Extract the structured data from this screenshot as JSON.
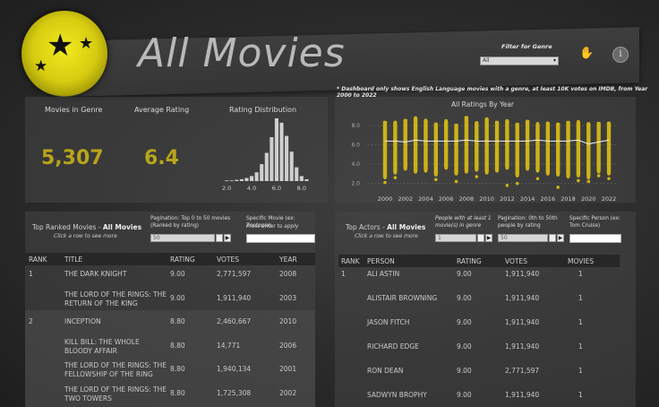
{
  "header": {
    "title": "All Movies",
    "filter_label": "Filter for Genre",
    "genre_selected": "All",
    "note": "* Dashboard only shows English Language movies with a genre, at least 10K votes on IMDB, from Year 2000 to 2022"
  },
  "icons": {
    "logo": "three-stars-logo",
    "hand": "hand-icon",
    "info": "info-icon",
    "info_glyph": "i",
    "hand_glyph": "✋",
    "star_glyph": "★",
    "dropdown_glyph": "▾",
    "next_glyph": "▶"
  },
  "kpis": {
    "movies_label": "Movies in Genre",
    "movies_value": "5,307",
    "rating_label": "Average Rating",
    "rating_value": "6.4",
    "dist_label": "Rating Distribution"
  },
  "distribution": {
    "ticks": [
      "2.0",
      "4.0",
      "6.0",
      "8.0"
    ],
    "tick_values": [
      2,
      4,
      6,
      8
    ],
    "xlim": [
      1.2,
      8.8
    ],
    "bins": [
      {
        "x": 2.0,
        "h": 0.01
      },
      {
        "x": 2.4,
        "h": 0.01
      },
      {
        "x": 2.8,
        "h": 0.02
      },
      {
        "x": 3.2,
        "h": 0.03
      },
      {
        "x": 3.6,
        "h": 0.05
      },
      {
        "x": 4.0,
        "h": 0.08
      },
      {
        "x": 4.4,
        "h": 0.14
      },
      {
        "x": 4.8,
        "h": 0.27
      },
      {
        "x": 5.2,
        "h": 0.45
      },
      {
        "x": 5.6,
        "h": 0.7
      },
      {
        "x": 6.0,
        "h": 1.0
      },
      {
        "x": 6.4,
        "h": 0.93
      },
      {
        "x": 6.8,
        "h": 0.72
      },
      {
        "x": 7.2,
        "h": 0.47
      },
      {
        "x": 7.6,
        "h": 0.22
      },
      {
        "x": 8.0,
        "h": 0.08
      },
      {
        "x": 8.4,
        "h": 0.03
      }
    ],
    "bar_color": "#cfcfcf"
  },
  "chart_data": {
    "type": "scatter",
    "title": "All Ratings By Year",
    "xlabel": "",
    "ylabel": "",
    "ylim": [
      1.5,
      9.5
    ],
    "y_ticks": [
      "8.0",
      "6.0",
      "4.0",
      "2.0"
    ],
    "y_tick_values": [
      8,
      6,
      4,
      2
    ],
    "x_ticks": [
      "2000",
      "2002",
      "2004",
      "2006",
      "2008",
      "2010",
      "2012",
      "2014",
      "2016",
      "2018",
      "2020",
      "2022"
    ],
    "years": [
      2000,
      2001,
      2002,
      2003,
      2004,
      2005,
      2006,
      2007,
      2008,
      2009,
      2010,
      2011,
      2012,
      2013,
      2014,
      2015,
      2016,
      2017,
      2018,
      2019,
      2020,
      2021,
      2022
    ],
    "band_min": [
      2.6,
      3.1,
      3.5,
      3.2,
      3.3,
      2.9,
      3.6,
      3.0,
      3.2,
      3.4,
      3.1,
      3.3,
      3.6,
      2.8,
      3.5,
      3.3,
      3.0,
      2.9,
      2.7,
      2.8,
      2.6,
      3.2,
      3.0
    ],
    "band_max": [
      8.5,
      8.4,
      8.7,
      8.9,
      8.6,
      8.3,
      8.5,
      8.2,
      9.0,
      8.4,
      8.8,
      8.5,
      8.6,
      8.3,
      8.6,
      8.2,
      8.4,
      8.3,
      8.5,
      8.4,
      8.3,
      8.4,
      8.4
    ],
    "mean": [
      6.4,
      6.4,
      6.3,
      6.5,
      6.4,
      6.4,
      6.4,
      6.4,
      6.5,
      6.4,
      6.4,
      6.4,
      6.4,
      6.4,
      6.4,
      6.5,
      6.4,
      6.4,
      6.4,
      6.5,
      6.1,
      6.3,
      6.5
    ],
    "low_outliers": [
      [
        2000,
        2.1
      ],
      [
        2001,
        2.6
      ],
      [
        2005,
        2.4
      ],
      [
        2007,
        2.2
      ],
      [
        2009,
        2.7
      ],
      [
        2012,
        1.8
      ],
      [
        2013,
        2.0
      ],
      [
        2015,
        2.5
      ],
      [
        2017,
        1.6
      ],
      [
        2019,
        2.3
      ],
      [
        2020,
        2.2
      ],
      [
        2021,
        2.8
      ],
      [
        2022,
        2.5
      ]
    ],
    "color": "#cdb318",
    "mean_color": "#f0f0f0"
  },
  "movies": {
    "title_prefix": "Top Ranked Movies - ",
    "title_genre": "All Movies",
    "subtitle": "Click a row to see more",
    "pagination_label": "Pagination: Top 0 to 50 movies (Ranked by rating)",
    "pagination_value": "50",
    "specific_label": "Specific Movie (ex: Zootopia)",
    "specific_hint": "Press enter to apply",
    "headers": [
      "RANK",
      "TITLE",
      "RATING",
      "VOTES",
      "YEAR"
    ],
    "rows": [
      {
        "rank": "1",
        "title": "THE DARK KNIGHT",
        "rating": "9.00",
        "votes": "2,771,597",
        "year": "2008"
      },
      {
        "rank": "",
        "title": "THE LORD OF THE RINGS: THE RETURN OF THE KING",
        "rating": "9.00",
        "votes": "1,911,940",
        "year": "2003"
      },
      {
        "rank": "2",
        "title": "INCEPTION",
        "rating": "8.80",
        "votes": "2,460,667",
        "year": "2010"
      },
      {
        "rank": "",
        "title": "KILL BILL: THE WHOLE BLOODY AFFAIR",
        "rating": "8.80",
        "votes": "14,771",
        "year": "2006"
      },
      {
        "rank": "",
        "title": "THE LORD OF THE RINGS: THE FELLOWSHIP OF THE RING",
        "rating": "8.80",
        "votes": "1,940,134",
        "year": "2001"
      },
      {
        "rank": "",
        "title": "THE LORD OF THE RINGS: THE TWO TOWERS",
        "rating": "8.80",
        "votes": "1,725,308",
        "year": "2002"
      }
    ]
  },
  "actors": {
    "title_prefix": "Top Actors - ",
    "title_genre": "All Movies",
    "subtitle": "Click a row to see more",
    "min_label": "People with at least 1 movie(s) in genre",
    "min_value": "1",
    "pagination_label": "Pagination: 0th to 50th people by rating",
    "pagination_value": "50",
    "specific_label": "Specific Person (ex: Tom Cruise)",
    "headers": [
      "RANK",
      "PERSON",
      "RATING",
      "VOTES",
      "MOVIES"
    ],
    "rows": [
      {
        "rank": "1",
        "person": "ALI ASTIN",
        "rating": "9.00",
        "votes": "1,911,940",
        "movies": "1"
      },
      {
        "rank": "",
        "person": "ALISTAIR BROWNING",
        "rating": "9.00",
        "votes": "1,911,940",
        "movies": "1"
      },
      {
        "rank": "",
        "person": "JASON FITCH",
        "rating": "9.00",
        "votes": "1,911,940",
        "movies": "1"
      },
      {
        "rank": "",
        "person": "RICHARD EDGE",
        "rating": "9.00",
        "votes": "1,911,940",
        "movies": "1"
      },
      {
        "rank": "",
        "person": "RON DEAN",
        "rating": "9.00",
        "votes": "2,771,597",
        "movies": "1"
      },
      {
        "rank": "",
        "person": "SADWYN BROPHY",
        "rating": "9.00",
        "votes": "1,911,940",
        "movies": "1"
      }
    ]
  }
}
